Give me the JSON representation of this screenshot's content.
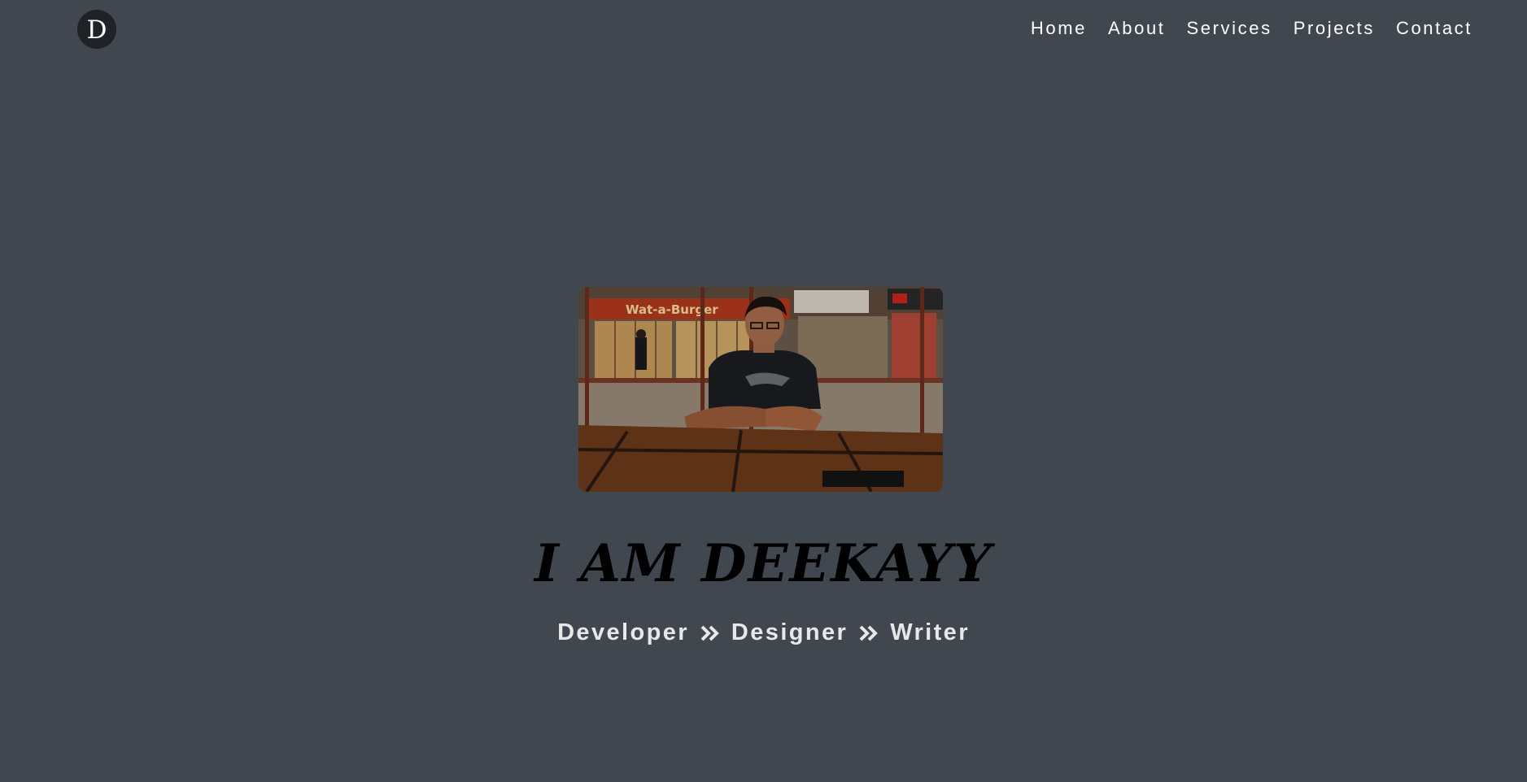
{
  "brand": {
    "logo_letter": "D"
  },
  "nav": {
    "items": [
      {
        "label": "Home"
      },
      {
        "label": "About"
      },
      {
        "label": "Services"
      },
      {
        "label": "Projects"
      },
      {
        "label": "Contact"
      }
    ]
  },
  "hero": {
    "photo_icon": "profile-photo",
    "storefront_sign": "Wat-a-Burger",
    "title": "I AM DEEKAYY",
    "roles": [
      "Developer",
      "Designer",
      "Writer"
    ],
    "separator_icon": "double-chevron-right-icon"
  },
  "colors": {
    "background": "#41474f",
    "logo_bg": "#1f2226",
    "nav_text": "#ffffff",
    "title_text": "#000000",
    "roles_text": "#e8e8e8"
  }
}
